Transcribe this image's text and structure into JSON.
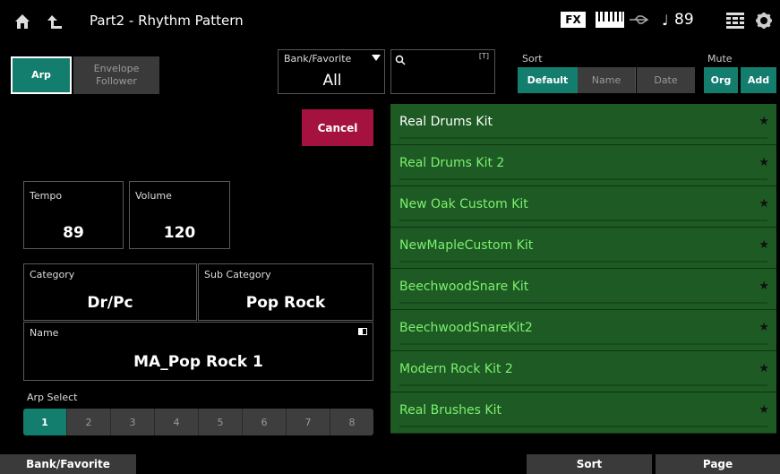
{
  "header": {
    "title": "Part2 - Rhythm Pattern",
    "fx_label": "FX",
    "tempo_note": "♩",
    "tempo_value": "89"
  },
  "mode": {
    "arp_label": "Arp",
    "envelope_label_1": "Envelope",
    "envelope_label_2": "Follower"
  },
  "bank": {
    "label": "Bank/Favorite",
    "value": "All"
  },
  "search": {
    "hint": "[T]",
    "value": ""
  },
  "sort": {
    "label": "Sort",
    "options": [
      "Default",
      "Name",
      "Date"
    ],
    "selected": "Default"
  },
  "mute": {
    "label": "Mute",
    "options": [
      "Org",
      "Add"
    ]
  },
  "cancel_label": "Cancel",
  "params": {
    "tempo_label": "Tempo",
    "tempo_value": "89",
    "volume_label": "Volume",
    "volume_value": "120",
    "category_label": "Category",
    "category_value": "Dr/Pc",
    "subcategory_label": "Sub Category",
    "subcategory_value": "Pop Rock",
    "name_label": "Name",
    "name_value": "MA_Pop Rock 1"
  },
  "arp_select": {
    "label": "Arp Select",
    "options": [
      "1",
      "2",
      "3",
      "4",
      "5",
      "6",
      "7",
      "8"
    ],
    "selected": "1"
  },
  "list": {
    "items": [
      {
        "label": "Real Drums Kit",
        "color": "#ffffff"
      },
      {
        "label": "Real Drums Kit 2",
        "color": "#7df06e"
      },
      {
        "label": "New Oak Custom Kit",
        "color": "#7df06e"
      },
      {
        "label": "NewMapleCustom Kit",
        "color": "#7df06e"
      },
      {
        "label": "BeechwoodSnare Kit",
        "color": "#7df06e"
      },
      {
        "label": "BeechwoodSnareKit2",
        "color": "#7df06e"
      },
      {
        "label": "Modern Rock Kit 2",
        "color": "#7df06e"
      },
      {
        "label": "Real Brushes Kit",
        "color": "#7df06e"
      }
    ]
  },
  "bottom": {
    "bank_favorite": "Bank/Favorite",
    "sort": "Sort",
    "page": "Page"
  },
  "colors": {
    "accent_teal": "#137d6e",
    "cancel_red": "#a5123f",
    "list_green": "#1d5a24"
  }
}
